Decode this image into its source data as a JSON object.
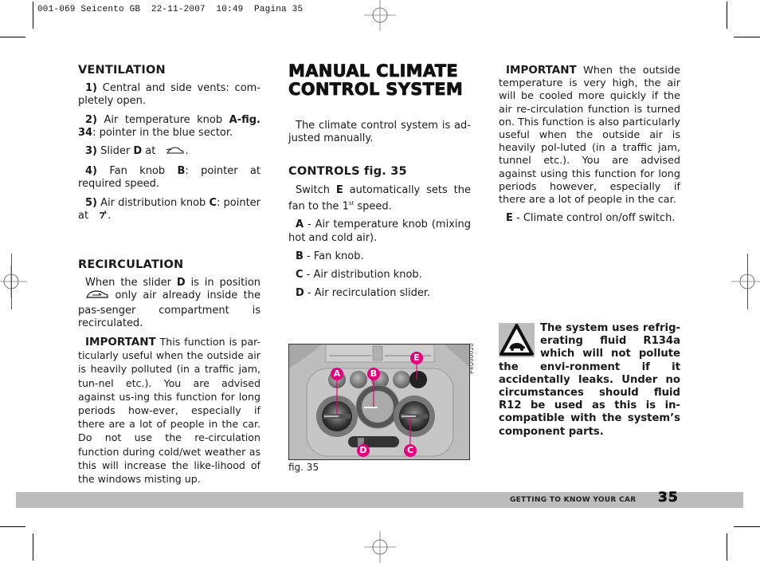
{
  "print_slug": "001-069 Seicento GB  22-11-2007  10:49  Pagina 35",
  "column_left": {
    "ventilation": {
      "heading": "VENTILATION",
      "steps": [
        {
          "num": "1)",
          "text": "Central and side vents: com-pletely open."
        },
        {
          "num": "2)",
          "text_a": "Air temperature knob ",
          "bold": "A-fig. 34",
          "text_b": ": pointer in the blue sector."
        },
        {
          "num": "3)",
          "text_a": "Slider ",
          "bold": "D",
          "text_b": " at ",
          "icon": "fresh-air-car-icon",
          "text_c": "."
        },
        {
          "num": "4)",
          "text_a": "Fan knob ",
          "bold": "B",
          "text_b": ": pointer at required speed."
        },
        {
          "num": "5)",
          "text_a": "Air distribution knob ",
          "bold": "C",
          "text_b": ": pointer at ",
          "icon": "air-to-feet-icon",
          "text_c": "."
        }
      ]
    },
    "recirculation": {
      "heading": "RECIRCULATION",
      "para1_a": "When the slider ",
      "para1_bold": "D",
      "para1_b": " is in position ",
      "para1_icon": "recirculation-car-icon",
      "para1_c": " only air already inside the pas-senger compartment is recirculated.",
      "important_label": "IMPORTANT",
      "important_text": " This function is par-ticularly useful when the outside air is heavily polluted (in a traffic jam, tun-nel etc.). You are advised against us-ing this function for long periods how-ever, especially if there are a lot of people in the car. Do not use the re-circulation function during cold/wet weather as this will increase the like-lihood of the windows misting up."
    }
  },
  "column_middle": {
    "title_line1": "MANUAL CLIMATE",
    "title_line2": "CONTROL SYSTEM",
    "intro": "The climate control system is ad-justed manually.",
    "controls_heading": "CONTROLS fig. 35",
    "switch_a": "Switch ",
    "switch_bold": "E",
    "switch_b": " automatically sets the fan to the 1",
    "switch_sup": "st",
    "switch_c": " speed.",
    "legend": [
      {
        "key": "A",
        "text": " - Air temperature knob (mixing hot and cold air)."
      },
      {
        "key": "B",
        "text": " - Fan knob."
      },
      {
        "key": "C",
        "text": " - Air distribution knob."
      },
      {
        "key": "D",
        "text": " - Air recirculation slider."
      }
    ],
    "figure": {
      "caption": "fig. 35",
      "code": "P4Q00020",
      "callouts": [
        "A",
        "B",
        "C",
        "D",
        "E"
      ],
      "callout_color": "#e6007e"
    }
  },
  "column_right": {
    "important_label": "IMPORTANT",
    "important_text": " When the outside temperature is very high, the air will be cooled more quickly if the air re-circulation function is turned on. This function is also particularly useful when the outside air is heavily pol-luted (in a traffic jam, tunnel etc.). You are advised against using this function for long periods however, especially if there are a lot of people in the car.",
    "e_key": "E",
    "e_text": " - Climate control on/off switch.",
    "warning": {
      "icon": "environment-warning-triangle-icon",
      "text": "The system uses refrig-erating fluid R134a which will not pollute the envi-ronment if it accidentally leaks. Under no circumstances should fluid R12 be used as this is in-compatible with the system’s component parts."
    }
  },
  "footer": {
    "section": "GETTING TO KNOW YOUR CAR",
    "page_number": "35",
    "bar_color": "#bcbcbd"
  }
}
